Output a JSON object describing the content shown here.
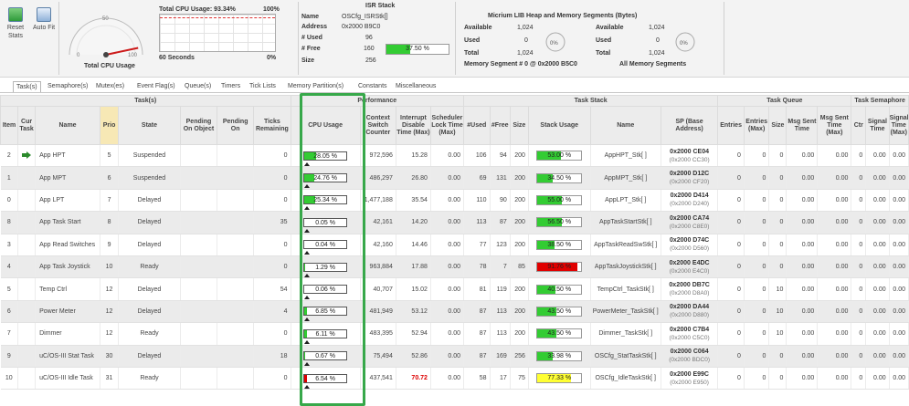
{
  "toolbar": {
    "reset_label": "Reset Stats",
    "autofit_label": "Auto Fit"
  },
  "cpu": {
    "title": "Total CPU Usage",
    "gauge_ticks": [
      "0",
      "50",
      "100"
    ],
    "total_label": "Total CPU Usage: 93.34%",
    "pct_top": "100%",
    "pct_bottom": "0%",
    "seconds": "60 Seconds",
    "usage": 93.34
  },
  "isr": {
    "title": "ISR Stack",
    "name_label": "Name",
    "name_val": "OSCfg_ISRStk[]",
    "addr_label": "Address",
    "addr_val": "0x2000 B9C0",
    "used_label": "# Used",
    "used_val": "96",
    "free_label": "# Free",
    "free_val": "160",
    "pct": "37.50 %",
    "pct_fraction": 0.375,
    "size_label": "Size",
    "size_val": "256"
  },
  "heap": {
    "title": "Micrium LIB Heap and Memory Segments (Bytes)",
    "left": {
      "available_label": "Available",
      "available": "1,024",
      "used_label": "Used",
      "used": "0",
      "pie": "0%",
      "total_label": "Total",
      "total": "1,024",
      "caption": "Memory Segment # 0 @ 0x2000 B5C0"
    },
    "right": {
      "available_label": "Available",
      "available": "1,024",
      "used_label": "Used",
      "used": "0",
      "pie": "0%",
      "total_label": "Total",
      "total": "1,024",
      "caption": "All Memory Segments"
    }
  },
  "tabs": [
    "Task(s)",
    "Semaphore(s)",
    "Mutex(es)",
    "Event Flag(s)",
    "Queue(s)",
    "Timers",
    "Tick Lists",
    "Memory Partition(s)",
    "Constants",
    "Miscellaneous"
  ],
  "groups": {
    "tasks": "Task(s)",
    "perf": "Performance",
    "stack": "Task Stack",
    "queue": "Task Queue",
    "sem": "Task Semaphore"
  },
  "cols": {
    "item": "Item",
    "cur": "Cur Task",
    "name": "Name",
    "prio": "Prio",
    "state": "State",
    "pend_obj": "Pending On Object",
    "pend_on": "Pending On",
    "ticks": "Ticks Remaining",
    "cpu": "CPU Usage",
    "ctx": "Context Switch Counter",
    "int_dis": "Interrupt Disable Time (Max)",
    "sched": "Scheduler Lock Time (Max)",
    "used": "#Used",
    "free": "#Free",
    "size": "Size",
    "stack_usage": "Stack Usage",
    "sname": "Name",
    "sp": "SP (Base Address)",
    "entries": "Entries",
    "entries_max": "Entries (Max)",
    "qsize": "Size",
    "msg_sent": "Msg Sent Time",
    "msg_sent_max": "Msg Sent Time (Max)",
    "ctr": "Ctr",
    "sig": "Signal Time",
    "sig_max": "Signal Time (Max)"
  },
  "colors": {
    "green": "#33cc33",
    "yellow": "#ffff33",
    "red": "#e00000",
    "highlight": "#37a84a"
  },
  "rows": [
    {
      "item": "2",
      "cur": true,
      "name": "App HPT",
      "prio": "5",
      "state": "Suspended",
      "ticks": "0",
      "cpu": "28.05 %",
      "cpu_v": 28.05,
      "ctx": "972,596",
      "int_dis": "15.28",
      "int_red": false,
      "sched": "0.00",
      "used": "106",
      "free": "94",
      "size": "200",
      "stack": "53.00 %",
      "stack_v": 53,
      "stack_color": "#33cc33",
      "sname": "AppHPT_Stk[ ]",
      "sp1": "0x2000 CE04",
      "sp2": "(0x2000 CC30)",
      "e": "0",
      "em": "0",
      "qs": "0",
      "ms": "0.00",
      "msm": "0.00",
      "ctr": "0",
      "sig": "0.00",
      "sigm": "0.00"
    },
    {
      "item": "1",
      "cur": false,
      "name": "App MPT",
      "prio": "6",
      "state": "Suspended",
      "ticks": "0",
      "cpu": "24.76 %",
      "cpu_v": 24.76,
      "ctx": "486,297",
      "int_dis": "26.80",
      "int_red": false,
      "sched": "0.00",
      "used": "69",
      "free": "131",
      "size": "200",
      "stack": "34.50 %",
      "stack_v": 34.5,
      "stack_color": "#33cc33",
      "sname": "AppMPT_Stk[ ]",
      "sp1": "0x2000 D12C",
      "sp2": "(0x2000 CF20)",
      "e": "0",
      "em": "0",
      "qs": "0",
      "ms": "0.00",
      "msm": "0.00",
      "ctr": "0",
      "sig": "0.00",
      "sigm": "0.00"
    },
    {
      "item": "0",
      "cur": false,
      "name": "App LPT",
      "prio": "7",
      "state": "Delayed",
      "ticks": "0",
      "cpu": "25.34 %",
      "cpu_v": 25.34,
      "ctx": "1,477,188",
      "int_dis": "35.54",
      "int_red": false,
      "sched": "0.00",
      "used": "110",
      "free": "90",
      "size": "200",
      "stack": "55.00 %",
      "stack_v": 55,
      "stack_color": "#33cc33",
      "sname": "AppLPT_Stk[ ]",
      "sp1": "0x2000 D414",
      "sp2": "(0x2000 D240)",
      "e": "0",
      "em": "0",
      "qs": "0",
      "ms": "0.00",
      "msm": "0.00",
      "ctr": "0",
      "sig": "0.00",
      "sigm": "0.00"
    },
    {
      "item": "8",
      "cur": false,
      "name": "App Task Start",
      "prio": "8",
      "state": "Delayed",
      "ticks": "35",
      "cpu": "0.05 %",
      "cpu_v": 0.05,
      "ctx": "42,161",
      "int_dis": "14.20",
      "int_red": false,
      "sched": "0.00",
      "used": "113",
      "free": "87",
      "size": "200",
      "stack": "56.50 %",
      "stack_v": 56.5,
      "stack_color": "#33cc33",
      "sname": "AppTaskStartStk[ ]",
      "sp1": "0x2000 CA74",
      "sp2": "(0x2000 C8E0)",
      "e": "0",
      "em": "0",
      "qs": "0",
      "ms": "0.00",
      "msm": "0.00",
      "ctr": "0",
      "sig": "0.00",
      "sigm": "0.00"
    },
    {
      "item": "3",
      "cur": false,
      "name": "App Read Switches",
      "prio": "9",
      "state": "Delayed",
      "ticks": "0",
      "cpu": "0.04 %",
      "cpu_v": 0.04,
      "ctx": "42,160",
      "int_dis": "14.46",
      "int_red": false,
      "sched": "0.00",
      "used": "77",
      "free": "123",
      "size": "200",
      "stack": "38.50 %",
      "stack_v": 38.5,
      "stack_color": "#33cc33",
      "sname": "AppTaskReadSwStk[ ]",
      "sp1": "0x2000 D74C",
      "sp2": "(0x2000 D560)",
      "e": "0",
      "em": "0",
      "qs": "0",
      "ms": "0.00",
      "msm": "0.00",
      "ctr": "0",
      "sig": "0.00",
      "sigm": "0.00"
    },
    {
      "item": "4",
      "cur": false,
      "name": "App Task Joystick",
      "prio": "10",
      "state": "Ready",
      "ticks": "0",
      "cpu": "1.29 %",
      "cpu_v": 1.29,
      "ctx": "963,884",
      "int_dis": "17.88",
      "int_red": false,
      "sched": "0.00",
      "used": "78",
      "free": "7",
      "size": "85",
      "stack": "91.76 %",
      "stack_v": 91.76,
      "stack_color": "#e00000",
      "sname": "AppTaskJoystickStk[ ]",
      "sp1": "0x2000 E4DC",
      "sp2": "(0x2000 E4C0)",
      "e": "0",
      "em": "0",
      "qs": "0",
      "ms": "0.00",
      "msm": "0.00",
      "ctr": "0",
      "sig": "0.00",
      "sigm": "0.00"
    },
    {
      "item": "5",
      "cur": false,
      "name": "Temp Ctrl",
      "prio": "12",
      "state": "Delayed",
      "ticks": "54",
      "cpu": "0.06 %",
      "cpu_v": 0.06,
      "ctx": "40,707",
      "int_dis": "15.02",
      "int_red": false,
      "sched": "0.00",
      "used": "81",
      "free": "119",
      "size": "200",
      "stack": "40.50 %",
      "stack_v": 40.5,
      "stack_color": "#33cc33",
      "sname": "TempCtrl_TaskStk[ ]",
      "sp1": "0x2000 DB7C",
      "sp2": "(0x2000 D8A0)",
      "e": "0",
      "em": "0",
      "qs": "10",
      "ms": "0.00",
      "msm": "0.00",
      "ctr": "0",
      "sig": "0.00",
      "sigm": "0.00"
    },
    {
      "item": "6",
      "cur": false,
      "name": "Power Meter",
      "prio": "12",
      "state": "Delayed",
      "ticks": "4",
      "cpu": "6.85 %",
      "cpu_v": 6.85,
      "ctx": "481,949",
      "int_dis": "53.12",
      "int_red": false,
      "sched": "0.00",
      "used": "87",
      "free": "113",
      "size": "200",
      "stack": "43.50 %",
      "stack_v": 43.5,
      "stack_color": "#33cc33",
      "sname": "PowerMeter_TaskStk[ ]",
      "sp1": "0x2000 DA44",
      "sp2": "(0x2000 D880)",
      "e": "0",
      "em": "0",
      "qs": "10",
      "ms": "0.00",
      "msm": "0.00",
      "ctr": "0",
      "sig": "0.00",
      "sigm": "0.00"
    },
    {
      "item": "7",
      "cur": false,
      "name": "Dimmer",
      "prio": "12",
      "state": "Ready",
      "ticks": "0",
      "cpu": "6.11 %",
      "cpu_v": 6.11,
      "ctx": "483,395",
      "int_dis": "52.94",
      "int_red": false,
      "sched": "0.00",
      "used": "87",
      "free": "113",
      "size": "200",
      "stack": "43.50 %",
      "stack_v": 43.5,
      "stack_color": "#33cc33",
      "sname": "Dimmer_TaskStk[ ]",
      "sp1": "0x2000 C7B4",
      "sp2": "(0x2000 C5C0)",
      "e": "0",
      "em": "0",
      "qs": "10",
      "ms": "0.00",
      "msm": "0.00",
      "ctr": "0",
      "sig": "0.00",
      "sigm": "0.00"
    },
    {
      "item": "9",
      "cur": false,
      "name": "uC/OS-III Stat Task",
      "prio": "30",
      "state": "Delayed",
      "ticks": "18",
      "cpu": "0.67 %",
      "cpu_v": 0.67,
      "ctx": "75,494",
      "int_dis": "52.86",
      "int_red": false,
      "sched": "0.00",
      "used": "87",
      "free": "169",
      "size": "256",
      "stack": "33.98 %",
      "stack_v": 33.98,
      "stack_color": "#33cc33",
      "sname": "OSCfg_StatTaskStk[ ]",
      "sp1": "0x2000 C064",
      "sp2": "(0x2000 BDC0)",
      "e": "0",
      "em": "0",
      "qs": "0",
      "ms": "0.00",
      "msm": "0.00",
      "ctr": "0",
      "sig": "0.00",
      "sigm": "0.00"
    },
    {
      "item": "10",
      "cur": false,
      "name": "uC/OS-III Idle Task",
      "prio": "31",
      "state": "Ready",
      "ticks": "0",
      "cpu": "6.54 %",
      "cpu_v": 6.54,
      "ctx": "437,541",
      "int_dis": "70.72",
      "int_red": true,
      "sched": "0.00",
      "used": "58",
      "free": "17",
      "size": "75",
      "stack": "77.33 %",
      "stack_v": 77.33,
      "stack_color": "#ffff33",
      "sname": "OSCfg_IdleTaskStk[ ]",
      "sp1": "0x2000 E99C",
      "sp2": "(0x2000 E950)",
      "e": "0",
      "em": "0",
      "qs": "0",
      "ms": "0.00",
      "msm": "0.00",
      "ctr": "0",
      "sig": "0.00",
      "sigm": "0.00"
    }
  ]
}
